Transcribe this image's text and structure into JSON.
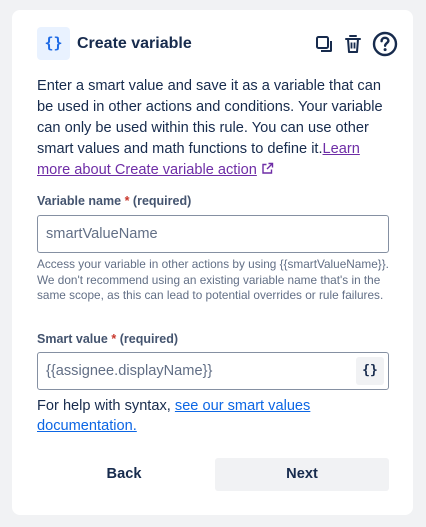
{
  "header": {
    "icon": "{}",
    "title": "Create variable",
    "actions": [
      "copy-icon",
      "trash-icon",
      "help-icon"
    ]
  },
  "description": {
    "text": "Enter a smart value and save it as a variable that can be used in other actions and conditions. Your variable can only be used within this rule. You can use other smart values and math functions to define it.",
    "link": "Learn more about Create variable action"
  },
  "variable_name": {
    "label": "Variable name",
    "asterisk": "*",
    "required": "(required)",
    "placeholder": "smartValueName",
    "value": "",
    "helper": "Access your variable in other actions by using {{smartValueName}}. We don't recommend using an existing variable name that's in the same scope, as this can lead to potential overrides or rule failures."
  },
  "smart_value": {
    "label": "Smart value",
    "asterisk": "*",
    "required": "(required)",
    "placeholder": "{{assignee.displayName}}",
    "value": "",
    "button": "{}"
  },
  "syntax_help": {
    "text": "For help with syntax, ",
    "link": "see our smart values documentation."
  },
  "footer": {
    "back": "Back",
    "next": "Next"
  },
  "colors": {
    "accent": "#1d6ae5",
    "link_visited": "#6e2da6",
    "link": "#0c66e4",
    "required": "#c9372c"
  }
}
